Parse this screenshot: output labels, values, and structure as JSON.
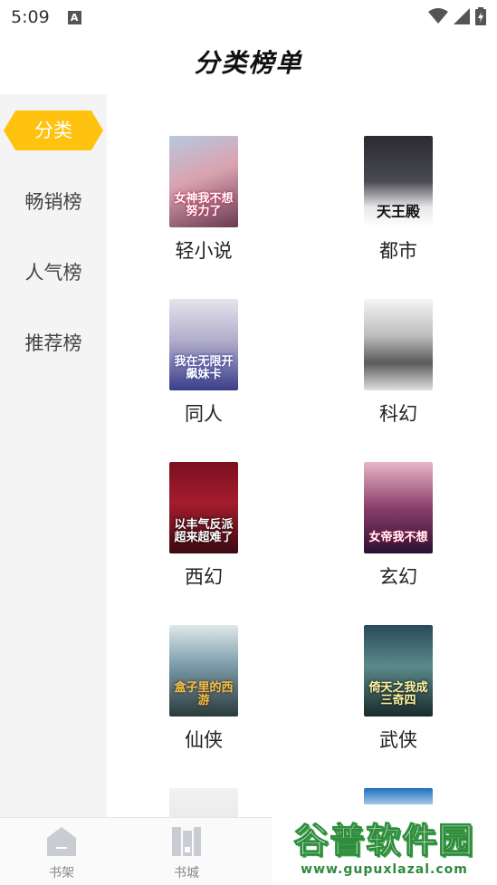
{
  "status_bar": {
    "time": "5:09",
    "notification_glyph": "A"
  },
  "header": {
    "title": "分类榜单"
  },
  "sidebar": {
    "items": [
      {
        "label": "分类",
        "active": true
      },
      {
        "label": "畅销榜",
        "active": false
      },
      {
        "label": "人气榜",
        "active": false
      },
      {
        "label": "推荐榜",
        "active": false
      }
    ]
  },
  "categories": [
    {
      "label": "轻小说",
      "cover_text": "女神我不想努力了"
    },
    {
      "label": "都市",
      "cover_text": "天王殿"
    },
    {
      "label": "同人",
      "cover_text": "我在无限开飙妹卡"
    },
    {
      "label": "科幻",
      "cover_text": ""
    },
    {
      "label": "西幻",
      "cover_text": "以丰气反派超来超难了"
    },
    {
      "label": "玄幻",
      "cover_text": "女帝我不想"
    },
    {
      "label": "仙侠",
      "cover_text": "盒子里的西游"
    },
    {
      "label": "武侠",
      "cover_text": "倚天之我成三奇四"
    }
  ],
  "bottom_nav": {
    "items": [
      {
        "label": "书架"
      },
      {
        "label": "书城"
      }
    ]
  },
  "watermark": {
    "main": "谷普软件园",
    "url": "www.gupuxlazal.com"
  },
  "colors": {
    "accent": "#ffc20e",
    "sidebar_bg": "#f4f4f4",
    "watermark_green": "#2e8b3c"
  }
}
